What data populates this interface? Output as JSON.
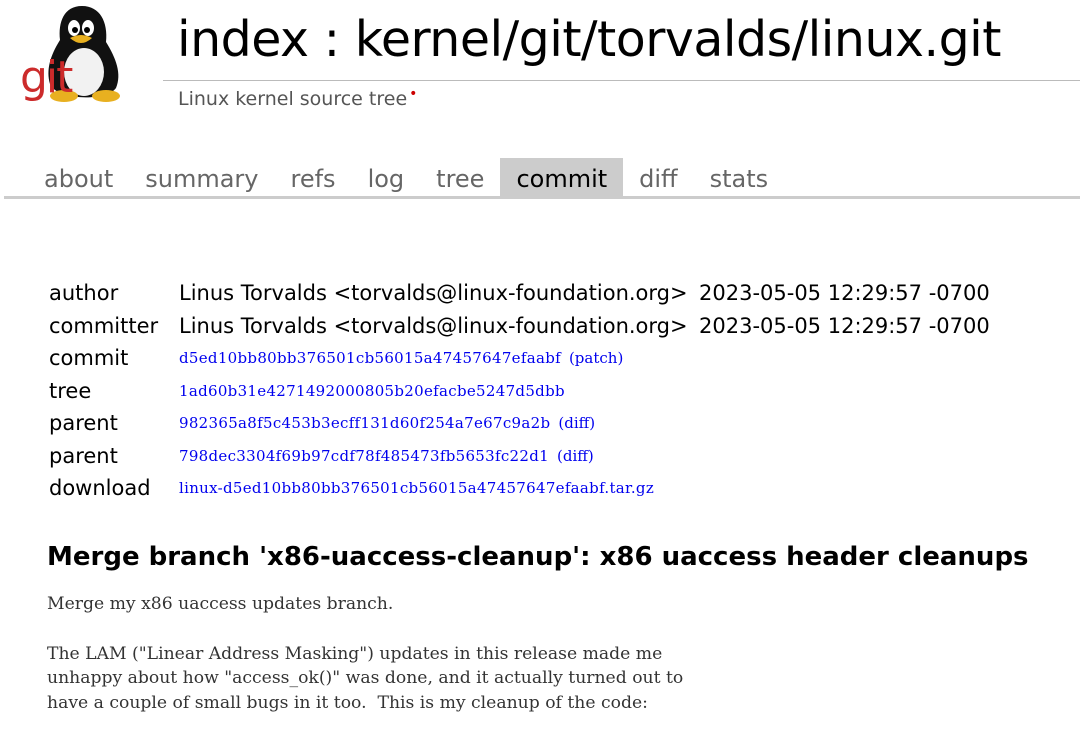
{
  "header": {
    "logo_text": "git",
    "title": "index : kernel/git/torvalds/linux.git",
    "description": "Linux kernel source tree",
    "description_dot": "•"
  },
  "tabs": [
    "about",
    "summary",
    "refs",
    "log",
    "tree",
    "commit",
    "diff",
    "stats"
  ],
  "active_tab": "commit",
  "commit_info": {
    "author_label": "author",
    "author_value": "Linus Torvalds <torvalds@linux-foundation.org>",
    "author_date": "2023-05-05 12:29:57 -0700",
    "committer_label": "committer",
    "committer_value": "Linus Torvalds <torvalds@linux-foundation.org>",
    "committer_date": "2023-05-05 12:29:57 -0700",
    "commit_label": "commit",
    "commit_hash": "d5ed10bb80bb376501cb56015a47457647efaabf",
    "commit_patch": "(patch)",
    "tree_label": "tree",
    "tree_hash": "1ad60b31e4271492000805b20efacbe5247d5dbb",
    "parent1_label": "parent",
    "parent1_hash": "982365a8f5c453b3ecff131d60f254a7e67c9a2b",
    "parent1_diff": "(diff)",
    "parent2_label": "parent",
    "parent2_hash": "798dec3304f69b97cdf78f485473fb5653fc22d1",
    "parent2_diff": "(diff)",
    "download_label": "download",
    "download_file": "linux-d5ed10bb80bb376501cb56015a47457647efaabf.tar.gz"
  },
  "subject": "Merge branch 'x86-uaccess-cleanup': x86 uaccess header cleanups",
  "message": "Merge my x86 uaccess updates branch.\n\nThe LAM (\"Linear Address Masking\") updates in this release made me\nunhappy about how \"access_ok()\" was done, and it actually turned out to\nhave a couple of small bugs in it too.  This is my cleanup of the code:",
  "colors": {
    "link": "#0000ee",
    "tab_active_bg": "#cccccc",
    "logo_red": "#cc2b2b"
  }
}
